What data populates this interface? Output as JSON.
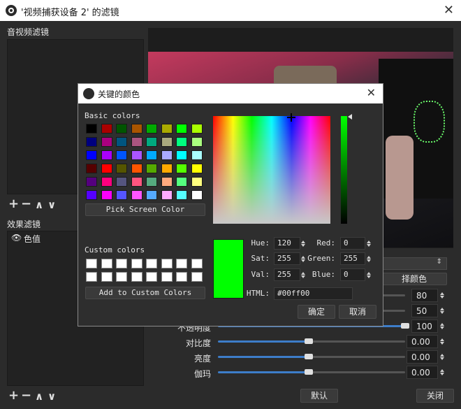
{
  "window": {
    "title": "'视频捕获设备 2' 的滤镜",
    "close_glyph": "✕"
  },
  "left": {
    "av_filters_label": "音视频滤镜",
    "effect_filters_label": "效果滤镜",
    "effect_filters": [
      {
        "name": "色值"
      }
    ],
    "toolbar": {
      "add": "+",
      "remove": "−",
      "up": "∧",
      "down": "∨"
    }
  },
  "right": {
    "partial_button": "择颜色",
    "sliders": [
      {
        "label": "",
        "value": "80",
        "fill": 0.0
      },
      {
        "label": "",
        "value": "50",
        "fill": 0.0
      },
      {
        "label": "不透明度",
        "value": "100",
        "fill": 1.0
      },
      {
        "label": "对比度",
        "value": "0.00",
        "fill": 0.5
      },
      {
        "label": "亮度",
        "value": "0.00",
        "fill": 0.5
      },
      {
        "label": "伽玛",
        "value": "0.00",
        "fill": 0.5
      }
    ],
    "default_button": "默认",
    "close_button": "关闭"
  },
  "dialog": {
    "title": "关键的颜色",
    "close_glyph": "✕",
    "basic_colors_label": "Basic colors",
    "basic_colors": [
      "#000000",
      "#aa0000",
      "#005500",
      "#aa5500",
      "#00aa00",
      "#aaaa00",
      "#00ff00",
      "#aaff00",
      "#00007f",
      "#aa007f",
      "#00557f",
      "#aa557f",
      "#00aa7f",
      "#aaaa7f",
      "#00ff7f",
      "#aaff7f",
      "#0000ff",
      "#aa00ff",
      "#0055ff",
      "#aa55ff",
      "#00aaff",
      "#aaaaff",
      "#00ffff",
      "#aaffff",
      "#550000",
      "#ff0000",
      "#555500",
      "#ff5500",
      "#55aa00",
      "#ffaa00",
      "#55ff00",
      "#ffff00",
      "#55007f",
      "#ff007f",
      "#55557f",
      "#ff557f",
      "#55aa7f",
      "#ffaa7f",
      "#55ff7f",
      "#ffff7f",
      "#5500ff",
      "#ff00ff",
      "#5555ff",
      "#ff55ff",
      "#55aaff",
      "#ffaaff",
      "#55ffff",
      "#ffffff"
    ],
    "pick_screen_label": "Pick Screen Color",
    "custom_colors_label": "Custom colors",
    "add_custom_label": "Add to Custom Colors",
    "current_color": "#00ff00",
    "hue_label": "Hue:",
    "hue": "120",
    "sat_label": "Sat:",
    "sat": "255",
    "val_label": "Val:",
    "val": "255",
    "red_label": "Red:",
    "red": "0",
    "green_label": "Green:",
    "green": "255",
    "blue_label": "Blue:",
    "blue": "0",
    "html_label": "HTML:",
    "html": "#00ff00",
    "ok_button": "确定",
    "cancel_button": "取消"
  }
}
